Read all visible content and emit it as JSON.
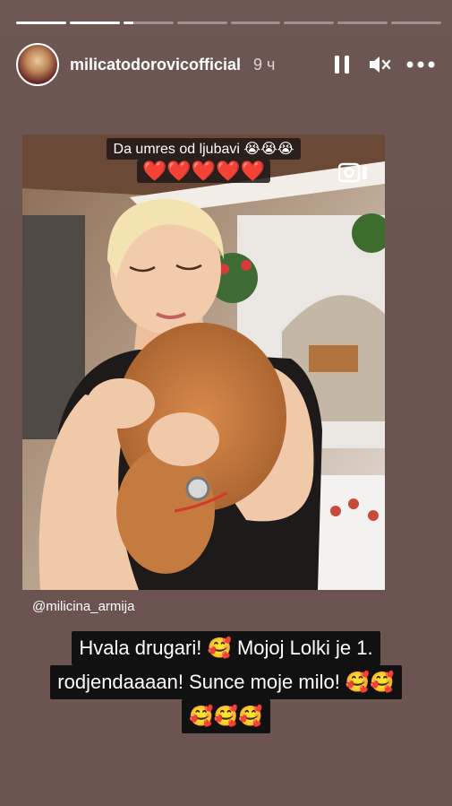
{
  "progress": {
    "segments": 8,
    "active_index": 2,
    "active_fraction": 0.2
  },
  "header": {
    "username": "milicatodorovicofficial",
    "time": "9 ч",
    "icons": [
      "pause-icon",
      "mute-icon",
      "more-icon"
    ]
  },
  "photo": {
    "caption_line1": "Da umres od ljubavi 😭😭😭",
    "caption_line2": "❤️❤️❤️❤️❤️",
    "icon": "instagram-camera-icon"
  },
  "mention": "@milicina_armija",
  "story_text": {
    "line1": "Hvala drugari! 🥰 Mojoj Lolki je  1.",
    "line2": "rodjendaaaan! Sunce moje milo! 🥰🥰",
    "line3": "🥰🥰🥰"
  },
  "colors": {
    "background": "#6b5550",
    "text_box": "#111111",
    "hearts": "#ff5a3d"
  }
}
